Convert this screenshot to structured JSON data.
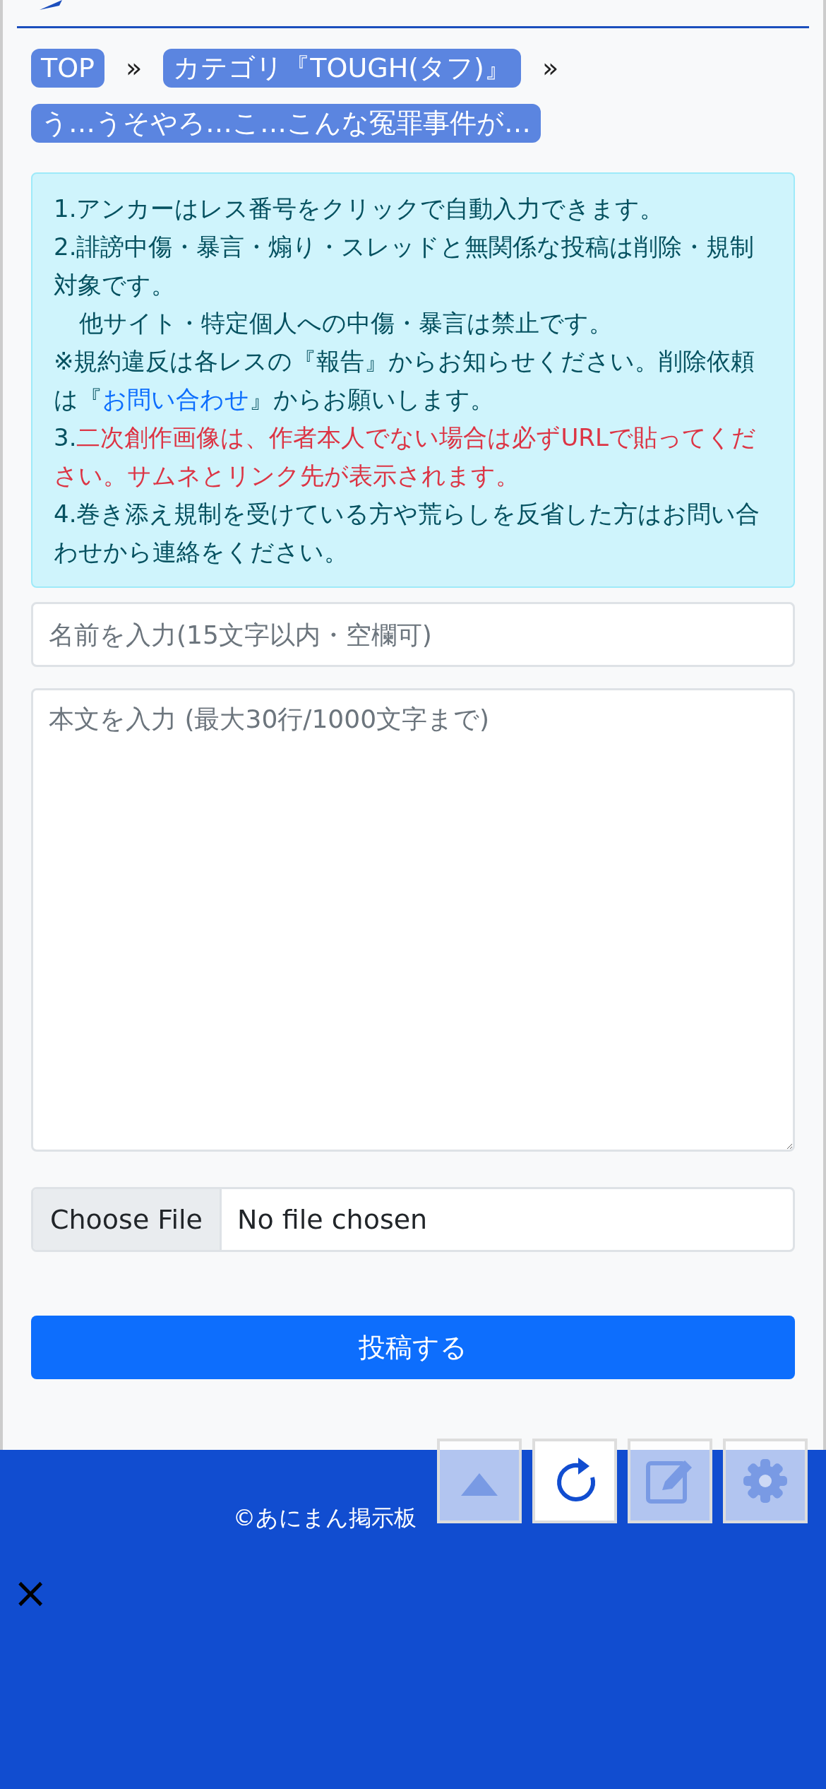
{
  "breadcrumbs": [
    {
      "label": "TOP"
    },
    {
      "label": "カテゴリ『TOUGH(タフ)』"
    },
    {
      "label": "う…うそやろ…こ…こんな冤罪事件が…"
    }
  ],
  "breadcrumb_separator": "»",
  "notice": [
    {
      "kind": "plain",
      "parts": [
        {
          "text": "1.アンカーはレス番号をクリックで自動入力できます。"
        }
      ]
    },
    {
      "kind": "plain",
      "parts": [
        {
          "text": "2.誹謗中傷・暴言・煽り・スレッドと無関係な投稿は削除・規制対象です。"
        }
      ]
    },
    {
      "kind": "indent",
      "parts": [
        {
          "text": "他サイト・特定個人への中傷・暴言は禁止です。"
        }
      ]
    },
    {
      "kind": "plain",
      "parts": [
        {
          "text": "※規約違反は各レスの『報告』からお知らせください。削除依頼は『"
        },
        {
          "text": "お問い合わせ",
          "link": true
        },
        {
          "text": "』からお願いします。"
        }
      ]
    },
    {
      "kind": "warning",
      "parts": [
        {
          "text": "3."
        },
        {
          "text": "二次創作画像は、作者本人でない場合は必ずURLで貼ってください。サムネとリンク先が表示されます。",
          "red": true
        }
      ]
    },
    {
      "kind": "plain",
      "parts": [
        {
          "text": "4.巻き添え規制を受けている方や荒らしを反省した方はお問い合わせから連絡をください。"
        }
      ]
    }
  ],
  "name_field": {
    "placeholder": "名前を入力(15文字以内・空欄可)"
  },
  "body_field": {
    "placeholder": "本文を入力 (最大30行/1000文字まで)"
  },
  "file_field": {
    "button": "Choose File",
    "status": "No file chosen"
  },
  "submit_button": "投稿する",
  "footer": {
    "copyright": "©あにまん掲示板",
    "close": "×"
  },
  "floating_buttons": [
    {
      "kind": "up",
      "disabled": true
    },
    {
      "kind": "reload",
      "disabled": false
    },
    {
      "kind": "edit",
      "disabled": true
    },
    {
      "kind": "settings",
      "disabled": true
    }
  ]
}
